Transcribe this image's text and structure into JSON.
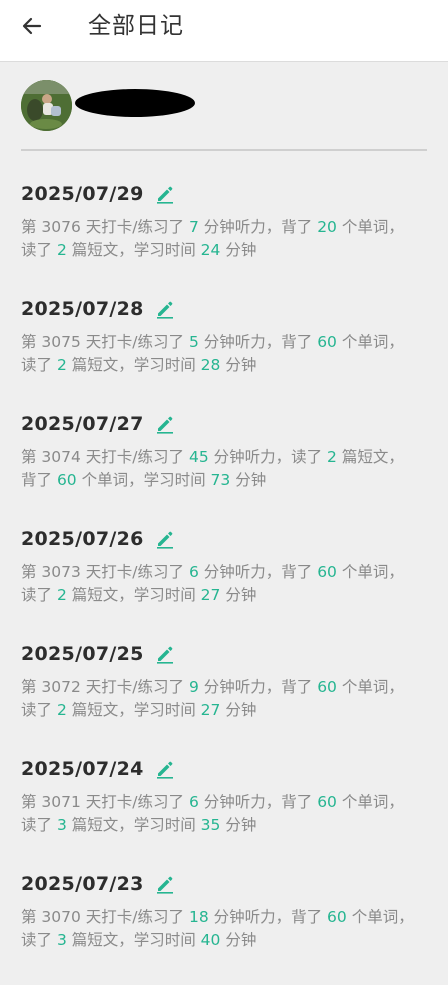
{
  "header": {
    "title": "全部日记"
  },
  "profile": {
    "avatar": "avatar-photo",
    "name_redacted": true
  },
  "colors": {
    "accent": "#26b591",
    "text_gray": "#8a8a8a",
    "date_text": "#2d2d2d",
    "background": "#efefef"
  },
  "entries": [
    {
      "date": "2025/07/29",
      "parts": [
        {
          "t": "第 3076 天打卡/练习了 "
        },
        {
          "t": "7",
          "n": true
        },
        {
          "t": " 分钟听力，背了 "
        },
        {
          "t": "20",
          "n": true
        },
        {
          "t": " 个单词，读了 "
        },
        {
          "t": "2",
          "n": true
        },
        {
          "t": " 篇短文，学习时间 "
        },
        {
          "t": "24",
          "n": true
        },
        {
          "t": " 分钟"
        }
      ]
    },
    {
      "date": "2025/07/28",
      "parts": [
        {
          "t": "第 3075 天打卡/练习了 "
        },
        {
          "t": "5",
          "n": true
        },
        {
          "t": " 分钟听力，背了 "
        },
        {
          "t": "60",
          "n": true
        },
        {
          "t": " 个单词，读了 "
        },
        {
          "t": "2",
          "n": true
        },
        {
          "t": " 篇短文，学习时间 "
        },
        {
          "t": "28",
          "n": true
        },
        {
          "t": " 分钟"
        }
      ]
    },
    {
      "date": "2025/07/27",
      "parts": [
        {
          "t": "第 3074 天打卡/练习了 "
        },
        {
          "t": "45",
          "n": true
        },
        {
          "t": " 分钟听力，读了 "
        },
        {
          "t": "2",
          "n": true
        },
        {
          "t": " 篇短文，背了 "
        },
        {
          "t": "60",
          "n": true
        },
        {
          "t": " 个单词，学习时间 "
        },
        {
          "t": "73",
          "n": true
        },
        {
          "t": " 分钟"
        }
      ]
    },
    {
      "date": "2025/07/26",
      "parts": [
        {
          "t": "第 3073 天打卡/练习了 "
        },
        {
          "t": "6",
          "n": true
        },
        {
          "t": " 分钟听力，背了 "
        },
        {
          "t": "60",
          "n": true
        },
        {
          "t": " 个单词，读了 "
        },
        {
          "t": "2",
          "n": true
        },
        {
          "t": " 篇短文，学习时间 "
        },
        {
          "t": "27",
          "n": true
        },
        {
          "t": " 分钟"
        }
      ]
    },
    {
      "date": "2025/07/25",
      "parts": [
        {
          "t": "第 3072 天打卡/练习了 "
        },
        {
          "t": "9",
          "n": true
        },
        {
          "t": " 分钟听力，背了 "
        },
        {
          "t": "60",
          "n": true
        },
        {
          "t": " 个单词，读了 "
        },
        {
          "t": "2",
          "n": true
        },
        {
          "t": " 篇短文，学习时间 "
        },
        {
          "t": "27",
          "n": true
        },
        {
          "t": " 分钟"
        }
      ]
    },
    {
      "date": "2025/07/24",
      "parts": [
        {
          "t": "第 3071 天打卡/练习了 "
        },
        {
          "t": "6",
          "n": true
        },
        {
          "t": " 分钟听力，背了 "
        },
        {
          "t": "60",
          "n": true
        },
        {
          "t": " 个单词，读了 "
        },
        {
          "t": "3",
          "n": true
        },
        {
          "t": " 篇短文，学习时间 "
        },
        {
          "t": "35",
          "n": true
        },
        {
          "t": " 分钟"
        }
      ]
    },
    {
      "date": "2025/07/23",
      "parts": [
        {
          "t": "第 3070 天打卡/练习了 "
        },
        {
          "t": "18",
          "n": true
        },
        {
          "t": " 分钟听力，背了 "
        },
        {
          "t": "60",
          "n": true
        },
        {
          "t": " 个单词，读了 "
        },
        {
          "t": "3",
          "n": true
        },
        {
          "t": " 篇短文，学习时间 "
        },
        {
          "t": "40",
          "n": true
        },
        {
          "t": " 分钟"
        }
      ]
    }
  ]
}
